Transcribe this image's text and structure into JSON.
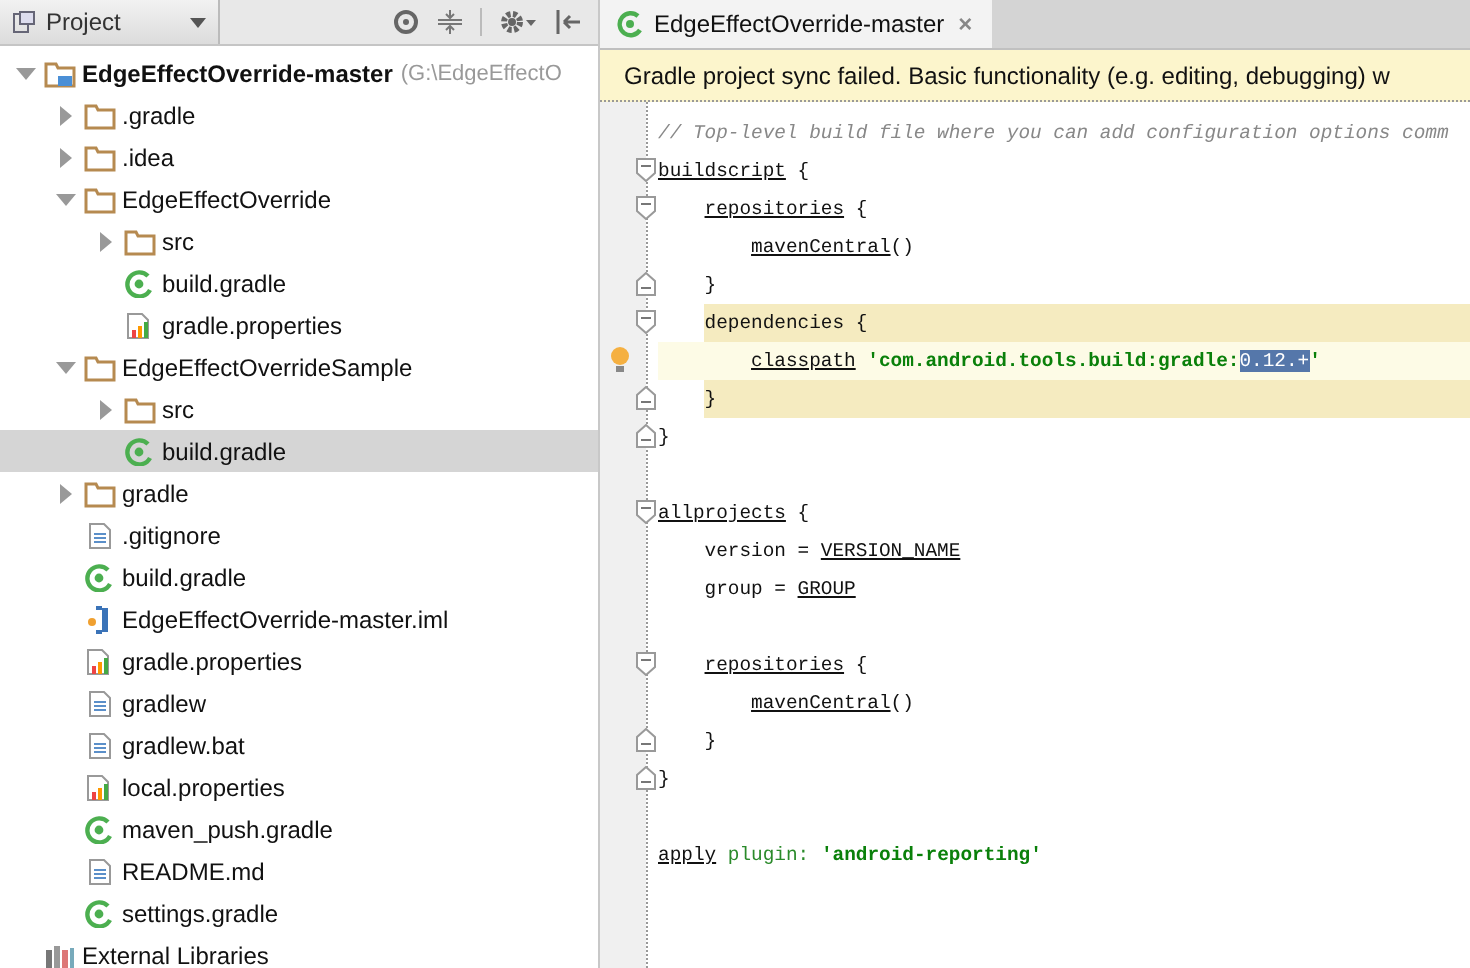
{
  "project_panel": {
    "view_selector": "Project",
    "tree": [
      {
        "label": "EdgeEffectOverride-master",
        "path": "(G:\\EdgeEffectO",
        "kind": "module",
        "expanded": true,
        "selected": false,
        "children": [
          {
            "label": ".gradle",
            "kind": "folder",
            "expanded": false,
            "selected": false
          },
          {
            "label": ".idea",
            "kind": "folder",
            "expanded": false,
            "selected": false
          },
          {
            "label": "EdgeEffectOverride",
            "kind": "folder",
            "expanded": true,
            "selected": false,
            "children": [
              {
                "label": "src",
                "kind": "folder",
                "expanded": false,
                "selected": false
              },
              {
                "label": "build.gradle",
                "kind": "gradle",
                "selected": false
              },
              {
                "label": "gradle.properties",
                "kind": "properties",
                "selected": false
              }
            ]
          },
          {
            "label": "EdgeEffectOverrideSample",
            "kind": "folder",
            "expanded": true,
            "selected": false,
            "children": [
              {
                "label": "src",
                "kind": "folder",
                "expanded": false,
                "selected": false
              },
              {
                "label": "build.gradle",
                "kind": "gradle",
                "selected": true
              }
            ]
          },
          {
            "label": "gradle",
            "kind": "folder",
            "expanded": false,
            "selected": false
          },
          {
            "label": ".gitignore",
            "kind": "text",
            "selected": false
          },
          {
            "label": "build.gradle",
            "kind": "gradle",
            "selected": false
          },
          {
            "label": "EdgeEffectOverride-master.iml",
            "kind": "iml",
            "selected": false
          },
          {
            "label": "gradle.properties",
            "kind": "properties",
            "selected": false
          },
          {
            "label": "gradlew",
            "kind": "text",
            "selected": false
          },
          {
            "label": "gradlew.bat",
            "kind": "text",
            "selected": false
          },
          {
            "label": "local.properties",
            "kind": "properties",
            "selected": false
          },
          {
            "label": "maven_push.gradle",
            "kind": "gradle",
            "selected": false
          },
          {
            "label": "README.md",
            "kind": "text",
            "selected": false
          },
          {
            "label": "settings.gradle",
            "kind": "gradle",
            "selected": false
          }
        ]
      },
      {
        "label": "External Libraries",
        "kind": "libraries",
        "selected": false
      }
    ]
  },
  "editor": {
    "tabs": [
      {
        "label": "EdgeEffectOverride-master",
        "close": "×",
        "selected": true
      }
    ],
    "notification": "Gradle project sync failed. Basic functionality (e.g. editing, debugging) w",
    "lines": [
      {
        "tokens": [
          {
            "text": "// Top-level build file where you can add configuration options comm",
            "kind": "comment"
          }
        ]
      },
      {
        "fold_start": true,
        "tokens": [
          {
            "text": "buildscript",
            "kind": "ref"
          },
          {
            "text": " {",
            "kind": "plain"
          }
        ]
      },
      {
        "fold_start": true,
        "tokens": [
          {
            "text": "    repositories",
            "kind": "ref"
          },
          {
            "text": " {",
            "kind": "plain"
          }
        ]
      },
      {
        "tokens": [
          {
            "text": "        mavenCentral",
            "kind": "ref"
          },
          {
            "text": "()",
            "kind": "plain"
          }
        ]
      },
      {
        "fold_end": true,
        "tokens": [
          {
            "text": "    }",
            "kind": "plain"
          }
        ]
      },
      {
        "fold_start": true,
        "block_highlight": true,
        "tokens": [
          {
            "text": "    dependencies {",
            "kind": "plain"
          }
        ]
      },
      {
        "caret_line": true,
        "bulb": true,
        "tokens": [
          {
            "text": "        classpath",
            "kind": "ref"
          },
          {
            "text": " 'com.android.tools.build:gradle:",
            "kind": "string"
          },
          {
            "text": "0.12.+",
            "kind": "selection"
          },
          {
            "text": "'",
            "kind": "string"
          }
        ]
      },
      {
        "fold_end": true,
        "block_highlight": true,
        "tokens": [
          {
            "text": "    }",
            "kind": "plain"
          }
        ]
      },
      {
        "fold_end": true,
        "tokens": [
          {
            "text": "}",
            "kind": "plain"
          }
        ]
      },
      {
        "kind": "blank"
      },
      {
        "fold_start": true,
        "tokens": [
          {
            "text": "allprojects",
            "kind": "ref"
          },
          {
            "text": " {",
            "kind": "plain"
          }
        ]
      },
      {
        "tokens": [
          {
            "text": "    version = ",
            "kind": "plain"
          },
          {
            "text": "VERSION_NAME",
            "kind": "ref"
          }
        ]
      },
      {
        "tokens": [
          {
            "text": "    group = ",
            "kind": "plain"
          },
          {
            "text": "GROUP",
            "kind": "ref"
          }
        ]
      },
      {
        "kind": "blank"
      },
      {
        "fold_start": true,
        "tokens": [
          {
            "text": "    repositories",
            "kind": "ref"
          },
          {
            "text": " {",
            "kind": "plain"
          }
        ]
      },
      {
        "tokens": [
          {
            "text": "        mavenCentral",
            "kind": "ref"
          },
          {
            "text": "()",
            "kind": "plain"
          }
        ]
      },
      {
        "fold_end": true,
        "tokens": [
          {
            "text": "    }",
            "kind": "plain"
          }
        ]
      },
      {
        "fold_end": true,
        "tokens": [
          {
            "text": "}",
            "kind": "plain"
          }
        ]
      },
      {
        "kind": "blank"
      },
      {
        "tokens": [
          {
            "text": "apply",
            "kind": "ref"
          },
          {
            "text": " plugin:",
            "kind": "param"
          },
          {
            "text": " 'android-reporting'",
            "kind": "string"
          }
        ]
      }
    ]
  }
}
